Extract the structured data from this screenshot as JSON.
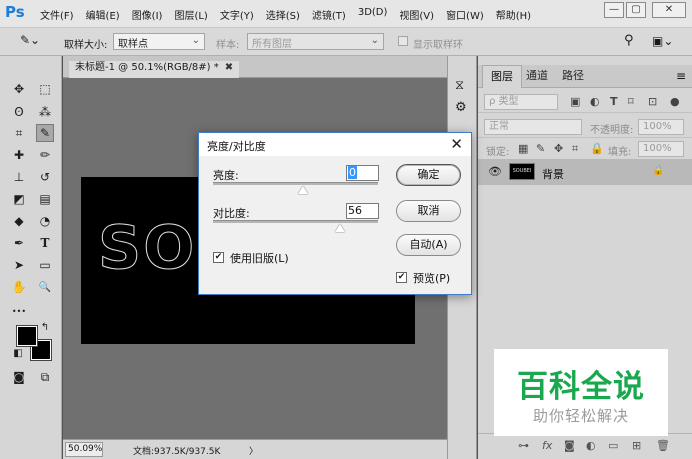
{
  "app": {
    "logo": "Ps",
    "menus": [
      "文件(F)",
      "编辑(E)",
      "图像(I)",
      "图层(L)",
      "文字(Y)",
      "选择(S)",
      "滤镜(T)",
      "3D(D)",
      "视图(V)",
      "窗口(W)",
      "帮助(H)"
    ],
    "window_controls": {
      "minimize": "—",
      "restore": "▢",
      "close": "✕"
    }
  },
  "options_bar": {
    "sample_size_label": "取样大小:",
    "sample_size_value": "取样点",
    "sample_label": "样本:",
    "sample_value": "所有图层",
    "show_ring_label": "显示取样环"
  },
  "document": {
    "tab_title": "未标题-1 @ 50.1%(RGB/8#) *",
    "tab_close": "✖",
    "canvas_text": "SOU",
    "zoom": "50.09%",
    "doc_info": "文档:937.5K/937.5K",
    "info_arrow": "〉"
  },
  "tools": [
    {
      "name": "move-tool",
      "glyph": "✥"
    },
    {
      "name": "marquee-tool",
      "glyph": "⬚"
    },
    {
      "name": "lasso-tool",
      "glyph": "ʘ"
    },
    {
      "name": "magic-wand-tool",
      "glyph": "⁂"
    },
    {
      "name": "crop-tool",
      "glyph": "⌗"
    },
    {
      "name": "eyedropper-tool",
      "glyph": "✎"
    },
    {
      "name": "healing-brush-tool",
      "glyph": "✚"
    },
    {
      "name": "brush-tool",
      "glyph": "✏"
    },
    {
      "name": "clone-stamp-tool",
      "glyph": "⊥"
    },
    {
      "name": "history-brush-tool",
      "glyph": "↺"
    },
    {
      "name": "eraser-tool",
      "glyph": "◩"
    },
    {
      "name": "gradient-tool",
      "glyph": "▤"
    },
    {
      "name": "blur-tool",
      "glyph": "◆"
    },
    {
      "name": "dodge-tool",
      "glyph": "◔"
    },
    {
      "name": "pen-tool",
      "glyph": "✒"
    },
    {
      "name": "type-tool",
      "glyph": "T"
    },
    {
      "name": "path-selection-tool",
      "glyph": "➤"
    },
    {
      "name": "rectangle-tool",
      "glyph": "▭"
    },
    {
      "name": "hand-tool",
      "glyph": "✋"
    },
    {
      "name": "zoom-tool",
      "glyph": "🔍"
    },
    {
      "name": "more-tools",
      "glyph": "•••"
    },
    {
      "name": "swap-colors",
      "glyph": "↰"
    },
    {
      "name": "default-colors",
      "glyph": "◧"
    },
    {
      "name": "quick-mask",
      "glyph": "◙"
    },
    {
      "name": "screen-mode",
      "glyph": "⧉"
    }
  ],
  "strip_icons": [
    "history-icon",
    "properties-icon"
  ],
  "layers_panel": {
    "tabs": [
      "图层",
      "通道",
      "路径"
    ],
    "filter_kind": "ρ 类型",
    "blend_mode": "正常",
    "opacity_label": "不透明度:",
    "opacity_value": "100%",
    "lock_label": "锁定:",
    "fill_label": "填充:",
    "fill_value": "100%",
    "layer_name": "背景",
    "layer_thumb_text": "SOUBEI"
  },
  "dialog": {
    "title": "亮度/对比度",
    "brightness_label": "亮度:",
    "brightness_value": "0",
    "contrast_label": "对比度:",
    "contrast_value": "56",
    "legacy_label": "使用旧版(L)",
    "ok_label": "确定",
    "cancel_label": "取消",
    "auto_label": "自动(A)",
    "preview_label": "预览(P)",
    "legacy_checked": true,
    "preview_checked": true
  },
  "watermark": {
    "title": "百科全说",
    "subtitle": "助你轻松解决"
  }
}
